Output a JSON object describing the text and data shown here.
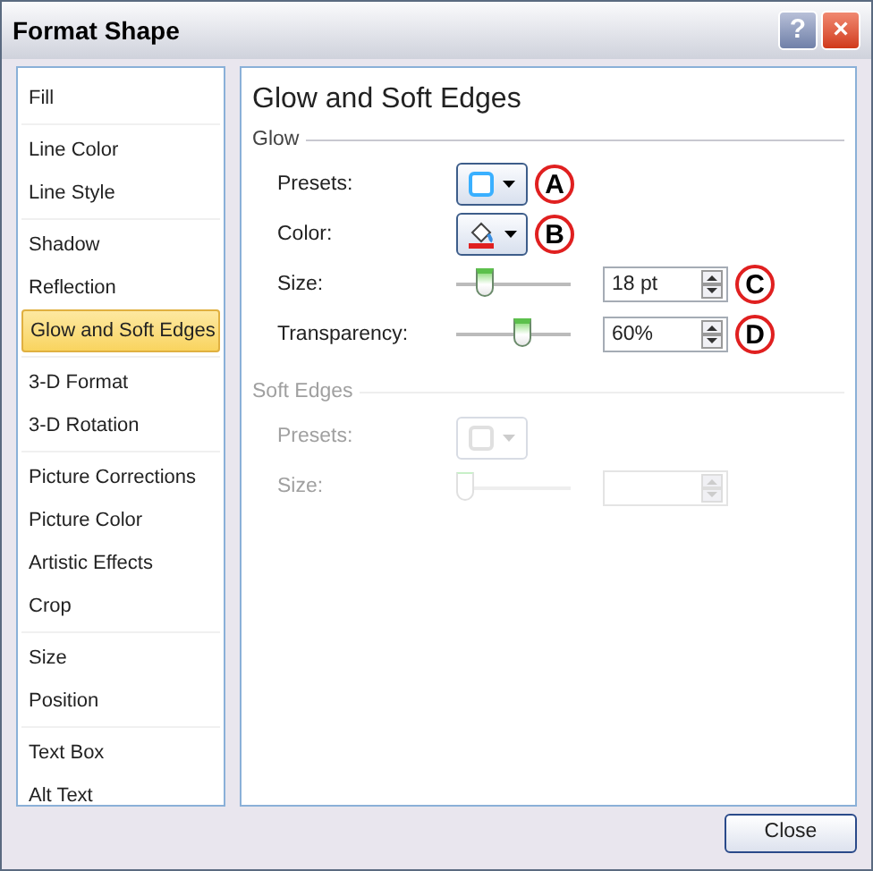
{
  "window": {
    "title": "Format Shape",
    "buttons": [
      "?",
      "×"
    ]
  },
  "sidebar": {
    "groups": [
      [
        {
          "label": "Fill",
          "selected": false
        }
      ],
      [
        {
          "label": "Line Color",
          "selected": false
        },
        {
          "label": "Line Style",
          "selected": false
        }
      ],
      [
        {
          "label": "Shadow",
          "selected": false
        },
        {
          "label": "Reflection",
          "selected": false
        },
        {
          "label": "Glow and Soft Edges",
          "selected": true
        }
      ],
      [
        {
          "label": "3-D Format",
          "selected": false
        },
        {
          "label": "3-D Rotation",
          "selected": false
        }
      ],
      [
        {
          "label": "Picture Corrections",
          "selected": false
        },
        {
          "label": "Picture Color",
          "selected": false
        },
        {
          "label": "Artistic Effects",
          "selected": false
        },
        {
          "label": "Crop",
          "selected": false
        }
      ],
      [
        {
          "label": "Size",
          "selected": false
        },
        {
          "label": "Position",
          "selected": false
        }
      ],
      [
        {
          "label": "Text Box",
          "selected": false
        },
        {
          "label": "Alt Text",
          "selected": false
        }
      ]
    ]
  },
  "panel": {
    "title": "Glow and Soft Edges",
    "sections": [
      {
        "title": "Glow",
        "disabled": false,
        "rows": [
          {
            "kind": "preset",
            "label": "Presets:",
            "callout": "A"
          },
          {
            "kind": "color",
            "label": "Color:",
            "callout": "B"
          },
          {
            "kind": "slider",
            "label": "Size:",
            "level": 0.2,
            "value": "18 pt",
            "callout": "C"
          },
          {
            "kind": "slider",
            "label": "Transparency:",
            "level": 0.6,
            "value": "60%",
            "callout": "D"
          }
        ]
      },
      {
        "title": "Soft Edges",
        "disabled": true,
        "rows": [
          {
            "kind": "preset",
            "label": "Presets:"
          },
          {
            "kind": "slider",
            "label": "Size:",
            "level": 0
          }
        ]
      }
    ]
  },
  "footer": {
    "button": "Close"
  }
}
